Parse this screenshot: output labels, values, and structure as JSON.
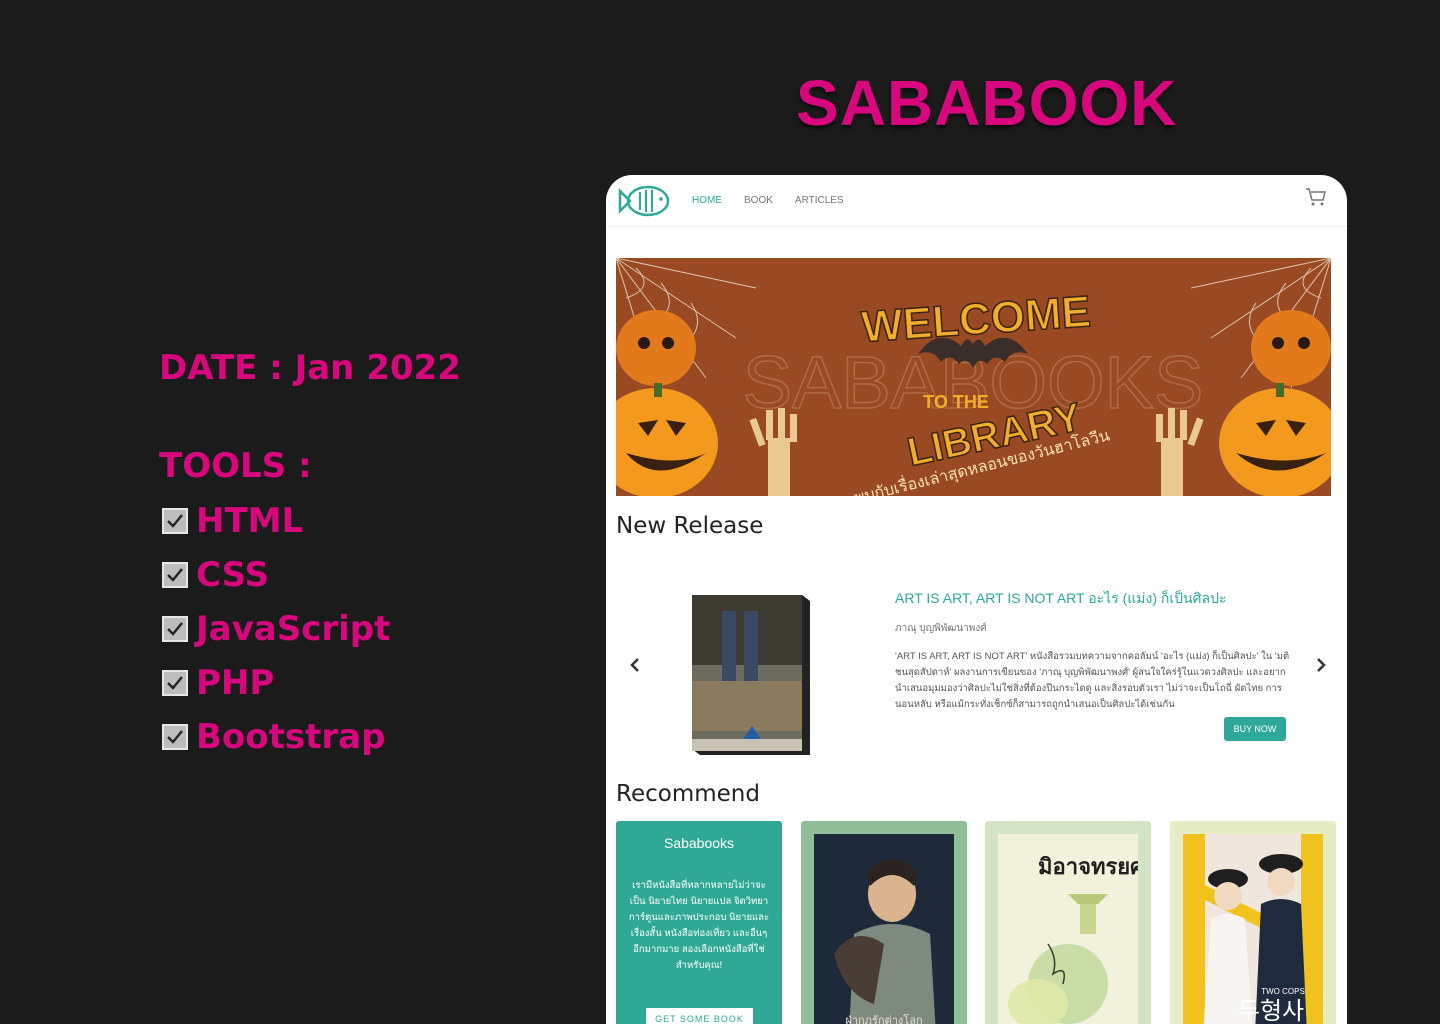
{
  "hero": {
    "title": "SABABOOK"
  },
  "meta": {
    "date": "DATE : Jan 2022",
    "tools_label": "TOOLS :",
    "tools": [
      "HTML",
      "CSS",
      "JavaScript",
      "PHP",
      "Bootstrap"
    ]
  },
  "site": {
    "nav": {
      "home": "HOME",
      "book": "BOOK",
      "articles": "ARTICLES"
    },
    "banner": {
      "line1": "WELCOME",
      "line2": "TO THE",
      "line3": "LIBRARY",
      "watermark": "SABABOOKS",
      "tagline": "พบกับเรื่องเล่าสุดหลอนของวันฮาโลวีน"
    },
    "new_release": {
      "title": "New Release",
      "book_title": "ART IS ART, ART IS NOT ART อะไร (แม่ง) ก็เป็นศิลปะ",
      "author": "ภาณุ บุญพิพัฒนาพงศ์",
      "description": "'ART IS ART, ART IS NOT ART' หนังสือรวมบทความจากคอลัมน์ 'อะไร (แม่ง) ก็เป็นศิลปะ' ใน 'มติชนสุดสัปดาห์' ผลงานการเขียนของ 'ภาณุ บุญพิพัฒนาพงศ์' ผู้สนใจใคร่รู้ในแวดวงศิลปะ และอยากนำเสนอมุมมองว่าศิลปะไม่ใช่สิ่งที่ต้องปีนกระไดดู และสิ่งรอบตัวเรา ไม่ว่าจะเป็นโถฉี่ ผัดไทย การนอนหลับ หรือแม้กระทั่งเช็กซ์ก็สามารถถูกนำเสนอเป็นศิลปะได้เช่นกัน",
      "buy_label": "BUY NOW"
    },
    "recommend": {
      "title": "Recommend",
      "card_name": "Sababooks",
      "card_desc": "เรามีหนังสือที่หลากหลายไม่ว่าจะเป็น นิยายไทย นิยายแปล จิตวิทยา การ์ตูนและภาพประกอบ นิยายและเรื่องสั้น หนังสือท่องเที่ยว และอื่นๆ อีกมากมาย ลองเลือกหนังสือที่ใช่สำหรับคุณ!",
      "card_button": "GET SOME BOOK",
      "books": [
        {
          "cover_title": "ฝ่ากฎรักต่างโลก",
          "bg": "#8fbe98"
        },
        {
          "cover_title": "มิอาจทรยศนาง",
          "bg": "#d3e3c6"
        },
        {
          "cover_title": "두형사",
          "subtitle": "TWO COPS",
          "bg": "#e6ecc4"
        }
      ]
    }
  },
  "colors": {
    "accent": "#d8077e",
    "teal": "#2ea898",
    "background": "#1b1b1b"
  }
}
